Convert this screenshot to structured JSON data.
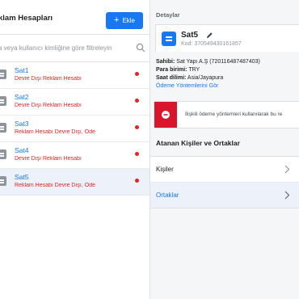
{
  "left_panel": {
    "title": "klam Hesapları",
    "add_button": {
      "icon": "plus-icon",
      "label": "Ekle"
    },
    "filter": {
      "placeholder": "a veya kullanıcı kimliğine göre filtreleyin",
      "icon": "search-icon"
    },
    "accounts": [
      {
        "name": "Sat1",
        "status": "Devre Dışı Reklam Hesabı",
        "selected": false
      },
      {
        "name": "Sat2",
        "status": "Devre Dışı Reklam Hesabı",
        "selected": false
      },
      {
        "name": "Sat3",
        "status": "Reklam Hesabı Devre Dışı, Öde",
        "selected": false
      },
      {
        "name": "Sat4",
        "status": "Devre Dışı Reklam Hesabı",
        "selected": false
      },
      {
        "name": "Sat5",
        "status": "Reklam Hesabı Devre Dışı, Öde",
        "selected": true
      }
    ]
  },
  "details": {
    "section_label": "Detaylar",
    "account_name": "Sat5",
    "code_label": "Kod:",
    "code_value": "370549430161857",
    "owner_label": "Sahibi:",
    "owner_value": "Sat Yapı A.Ş (720116487487403)",
    "currency_label": "Para birimi:",
    "currency_value": "TRY",
    "timezone_label": "Saat dilimi:",
    "timezone_value": "Asia/Jayapura",
    "payment_link": "Ödeme Yöntemlerini Gör",
    "error_message": "İlişkili ödeme yöntemleri kullanılarak bu re"
  },
  "assigned": {
    "title": "Atanan Kişiler ve Ortaklar",
    "items": [
      {
        "label": "Kişiler",
        "selected": false
      },
      {
        "label": "Ortaklar",
        "selected": true
      }
    ]
  },
  "colors": {
    "accent": "#1877f2",
    "error": "#e02424",
    "error_strip": "#d9152c",
    "selected_bg": "#edf2fa"
  }
}
